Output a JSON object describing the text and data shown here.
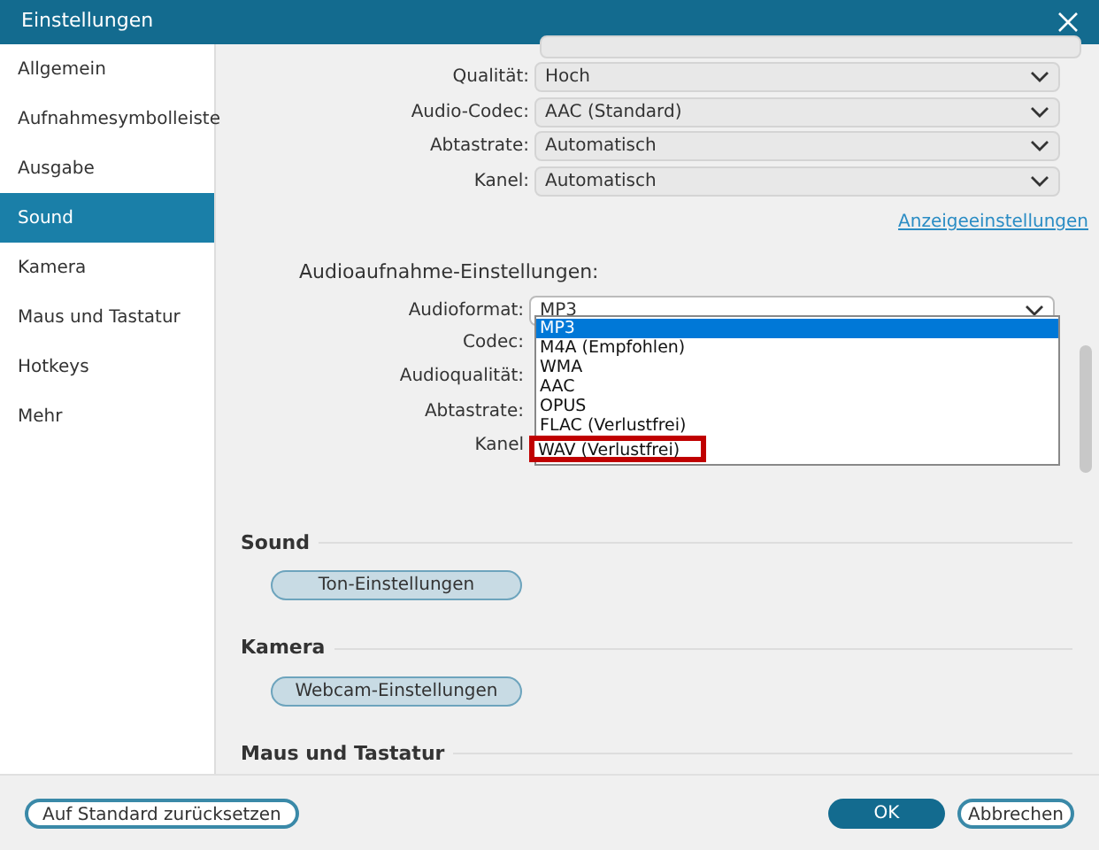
{
  "window": {
    "title": "Einstellungen"
  },
  "sidebar": {
    "items": [
      {
        "label": "Allgemein",
        "selected": false
      },
      {
        "label": "Aufnahmesymbolleiste",
        "selected": false
      },
      {
        "label": "Ausgabe",
        "selected": false
      },
      {
        "label": "Sound",
        "selected": true
      },
      {
        "label": "Kamera",
        "selected": false
      },
      {
        "label": "Maus und Tastatur",
        "selected": false
      },
      {
        "label": "Hotkeys",
        "selected": false
      },
      {
        "label": "Mehr",
        "selected": false
      }
    ]
  },
  "video_settings": {
    "fields": [
      {
        "label": "Qualität:",
        "value": "Hoch"
      },
      {
        "label": "Audio-Codec:",
        "value": "AAC (Standard)"
      },
      {
        "label": "Abtastrate:",
        "value": "Automatisch"
      },
      {
        "label": "Kanel:",
        "value": "Automatisch"
      }
    ],
    "link": "Anzeigeeinstellungen"
  },
  "audio_recording": {
    "heading": "Audioaufnahme-Einstellungen:",
    "format_label": "Audioformat:",
    "format_value": "MP3",
    "dropdown_options": [
      {
        "label": "MP3",
        "selected": true,
        "highlighted": false
      },
      {
        "label": "M4A (Empfohlen)",
        "selected": false,
        "highlighted": false
      },
      {
        "label": "WMA",
        "selected": false,
        "highlighted": false
      },
      {
        "label": "AAC",
        "selected": false,
        "highlighted": false
      },
      {
        "label": "OPUS",
        "selected": false,
        "highlighted": false
      },
      {
        "label": "FLAC (Verlustfrei)",
        "selected": false,
        "highlighted": false
      },
      {
        "label": "WAV (Verlustfrei)",
        "selected": false,
        "highlighted": true
      }
    ],
    "hidden_labels": [
      "Codec:",
      "Audioqualität:",
      "Abtastrate:",
      "Kanel"
    ]
  },
  "sections": [
    {
      "heading": "Sound",
      "button": "Ton-Einstellungen"
    },
    {
      "heading": "Kamera",
      "button": "Webcam-Einstellungen"
    },
    {
      "heading": "Maus und Tastatur"
    }
  ],
  "footer": {
    "reset_button": "Auf Standard zurücksetzen",
    "ok_button": "OK",
    "cancel_button": "Abbrechen"
  }
}
